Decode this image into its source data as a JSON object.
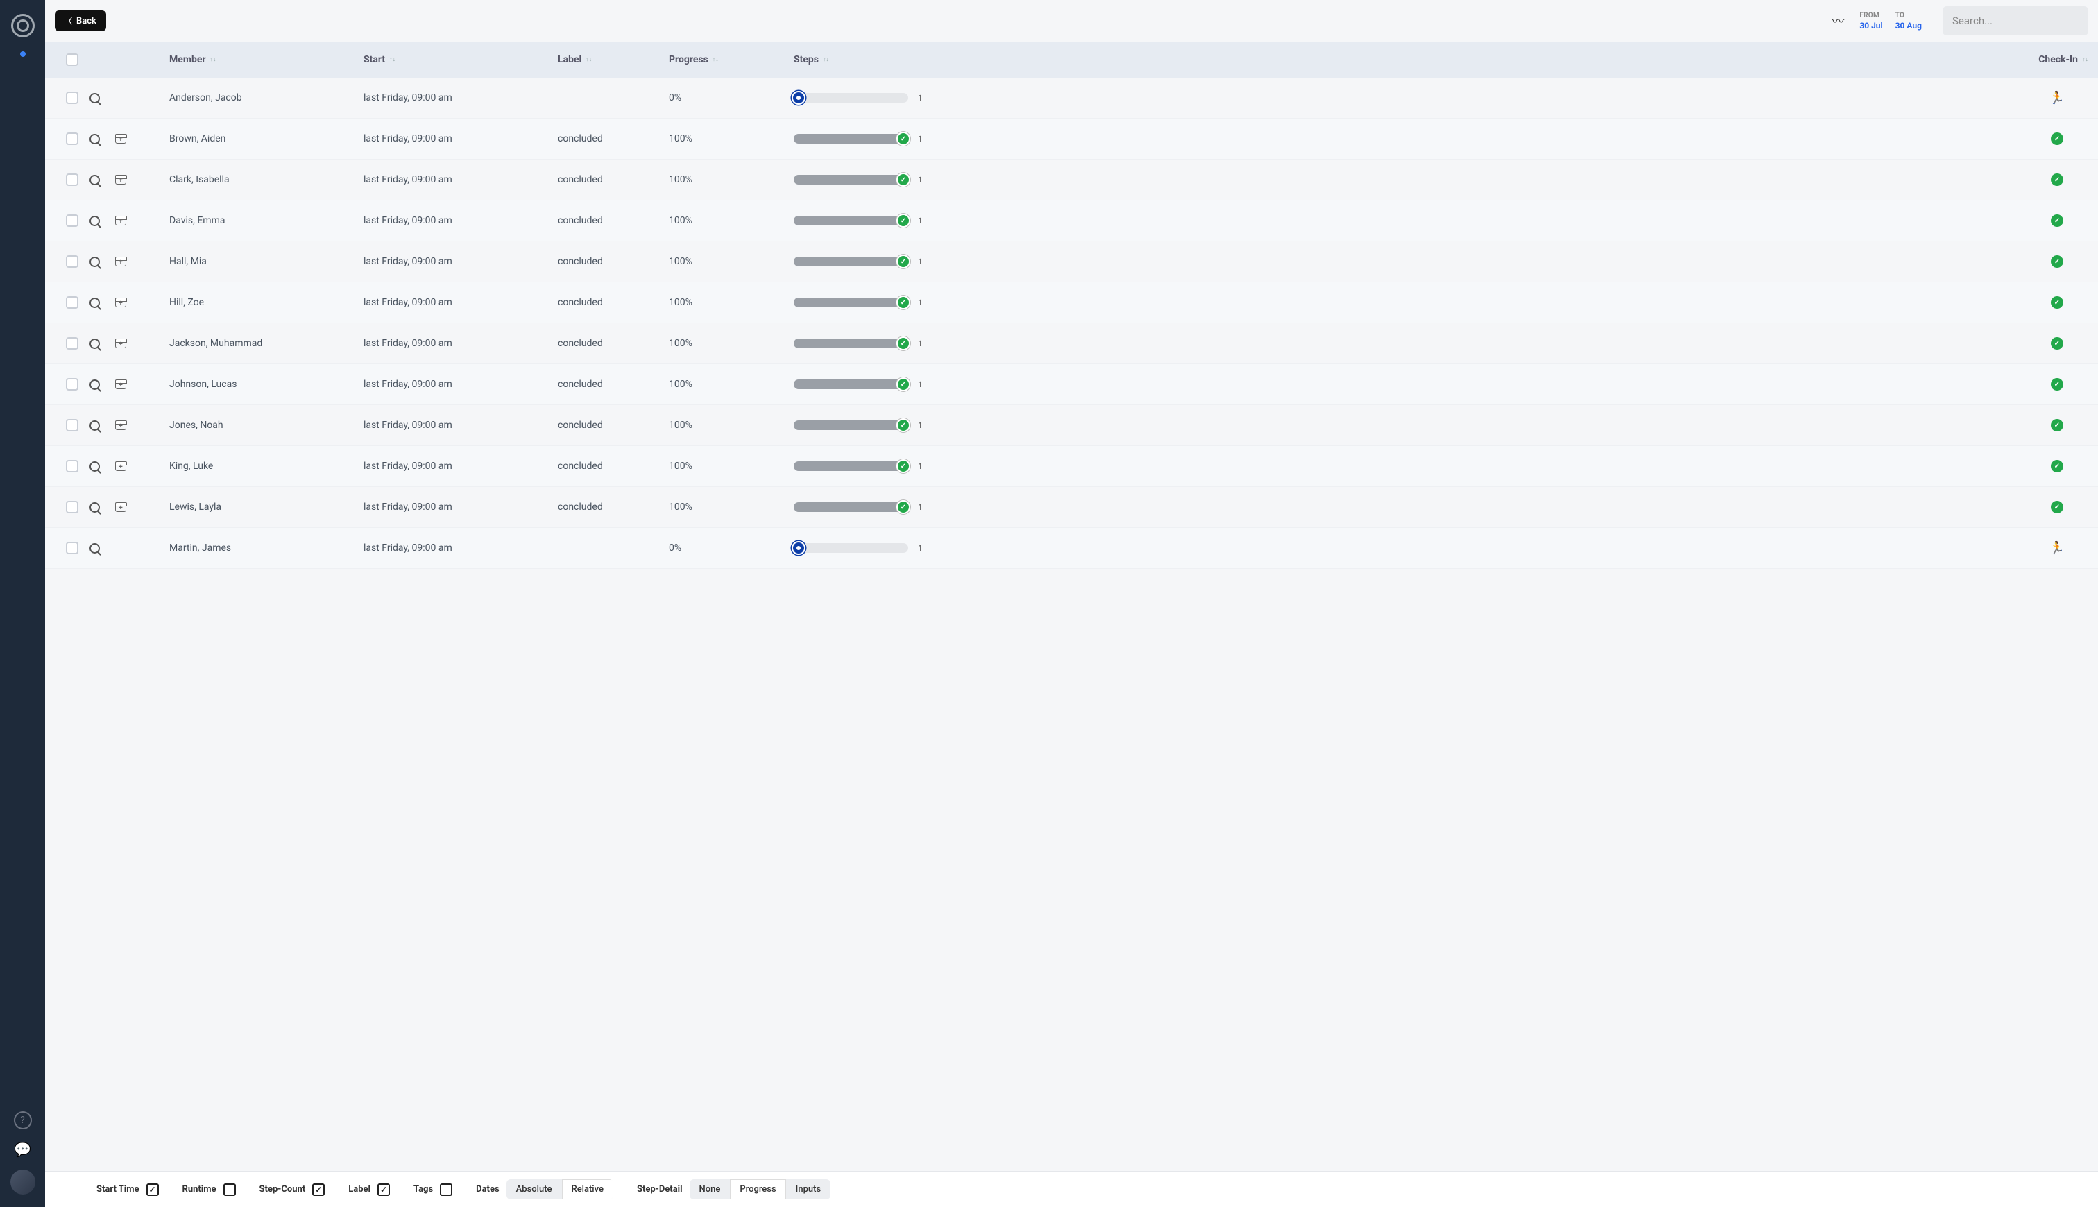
{
  "topbar": {
    "back": "Back",
    "search_placeholder": "Search...",
    "from_label": "FROM",
    "to_label": "TO",
    "from_value": "30 Jul",
    "to_value": "30 Aug"
  },
  "columns": {
    "member": "Member",
    "start": "Start",
    "label": "Label",
    "progress": "Progress",
    "steps": "Steps",
    "checkin": "Check-In"
  },
  "rows": [
    {
      "member": "Anderson, Jacob",
      "start": "last Friday, 09:00 am",
      "label": "",
      "progress": "0%",
      "steps": "1",
      "status": "running",
      "archivable": false
    },
    {
      "member": "Brown, Aiden",
      "start": "last Friday, 09:00 am",
      "label": "concluded",
      "progress": "100%",
      "steps": "1",
      "status": "done",
      "archivable": true
    },
    {
      "member": "Clark, Isabella",
      "start": "last Friday, 09:00 am",
      "label": "concluded",
      "progress": "100%",
      "steps": "1",
      "status": "done",
      "archivable": true
    },
    {
      "member": "Davis, Emma",
      "start": "last Friday, 09:00 am",
      "label": "concluded",
      "progress": "100%",
      "steps": "1",
      "status": "done",
      "archivable": true
    },
    {
      "member": "Hall, Mia",
      "start": "last Friday, 09:00 am",
      "label": "concluded",
      "progress": "100%",
      "steps": "1",
      "status": "done",
      "archivable": true
    },
    {
      "member": "Hill, Zoe",
      "start": "last Friday, 09:00 am",
      "label": "concluded",
      "progress": "100%",
      "steps": "1",
      "status": "done",
      "archivable": true
    },
    {
      "member": "Jackson, Muhammad",
      "start": "last Friday, 09:00 am",
      "label": "concluded",
      "progress": "100%",
      "steps": "1",
      "status": "done",
      "archivable": true
    },
    {
      "member": "Johnson, Lucas",
      "start": "last Friday, 09:00 am",
      "label": "concluded",
      "progress": "100%",
      "steps": "1",
      "status": "done",
      "archivable": true
    },
    {
      "member": "Jones, Noah",
      "start": "last Friday, 09:00 am",
      "label": "concluded",
      "progress": "100%",
      "steps": "1",
      "status": "done",
      "archivable": true
    },
    {
      "member": "King, Luke",
      "start": "last Friday, 09:00 am",
      "label": "concluded",
      "progress": "100%",
      "steps": "1",
      "status": "done",
      "archivable": true
    },
    {
      "member": "Lewis, Layla",
      "start": "last Friday, 09:00 am",
      "label": "concluded",
      "progress": "100%",
      "steps": "1",
      "status": "done",
      "archivable": true
    },
    {
      "member": "Martin, James",
      "start": "last Friday, 09:00 am",
      "label": "",
      "progress": "0%",
      "steps": "1",
      "status": "running",
      "archivable": false
    }
  ],
  "footer": {
    "start_time": "Start Time",
    "runtime": "Runtime",
    "step_count": "Step-Count",
    "label": "Label",
    "tags": "Tags",
    "dates": "Dates",
    "absolute": "Absolute",
    "relative": "Relative",
    "step_detail": "Step-Detail",
    "none": "None",
    "progress": "Progress",
    "inputs": "Inputs",
    "start_time_checked": true,
    "runtime_checked": false,
    "step_count_checked": true,
    "label_checked": true,
    "tags_checked": false,
    "dates_active": "Relative",
    "step_detail_active": "Progress"
  }
}
